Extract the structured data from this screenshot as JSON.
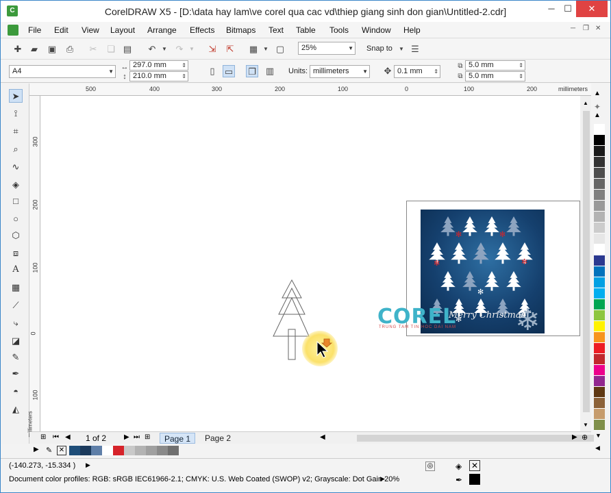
{
  "window": {
    "title": "CorelDRAW X5 - [D:\\data hay lam\\ve corel qua cac vd\\thiep giang sinh don gian\\Untitled-2.cdr]",
    "min": "─",
    "max": "☐",
    "close": "✕"
  },
  "menu": [
    "File",
    "Edit",
    "View",
    "Layout",
    "Arrange",
    "Effects",
    "Bitmaps",
    "Text",
    "Table",
    "Tools",
    "Window",
    "Help"
  ],
  "toolbar": {
    "zoom": "25%",
    "snap_to": "Snap to"
  },
  "property_bar": {
    "paper": "A4",
    "width": "297.0 mm",
    "height": "210.0 mm",
    "units_label": "Units:",
    "units": "millimeters",
    "nudge": "0.1 mm",
    "dup_x": "5.0 mm",
    "dup_y": "5.0 mm"
  },
  "ruler": {
    "h_labels": [
      "500",
      "400",
      "300",
      "200",
      "100",
      "0",
      "100",
      "200"
    ],
    "h_unit": "millimeters",
    "v_labels": [
      "300",
      "200",
      "100",
      "0",
      "100"
    ],
    "v_unit": "millimeters"
  },
  "artwork": {
    "corel_text": "COREL",
    "corel_sub": "TRUNG TAM TIN HOC DAI NAM",
    "greeting": "Merry Christmas"
  },
  "pages": {
    "counter": "1 of 2",
    "tabs": [
      "Page 1",
      "Page 2"
    ]
  },
  "status": {
    "coords": "(-140.273, -15.334 )",
    "profiles": "Document color profiles: RGB: sRGB IEC61966-2.1; CMYK: U.S. Web Coated (SWOP) v2; Grayscale: Dot Gain 20%"
  },
  "colors": {
    "palette": [
      "#ffffff",
      "#000000",
      "#1a1a1a",
      "#333333",
      "#4d4d4d",
      "#666666",
      "#808080",
      "#999999",
      "#b3b3b3",
      "#cccccc",
      "#e6e6e6",
      "#ffffff",
      "#2b3990",
      "#0072bc",
      "#00a0e3",
      "#00aeef",
      "#00a651",
      "#8dc63f",
      "#fff200",
      "#f7941d",
      "#ed1c24",
      "#c1272d",
      "#ec008c",
      "#92278f",
      "#603913",
      "#8c6239",
      "#c69c6d",
      "#7f8f4a",
      "#2e3192",
      "#662d91"
    ],
    "doc_palette": [
      "#1f4e79",
      "#1b3a5c",
      "#5f7fa8",
      "#ffffff",
      "#d6232a",
      "#c9c9c9",
      "#b3b3b3",
      "#a0a0a0",
      "#8a8a8a",
      "#707070"
    ]
  }
}
